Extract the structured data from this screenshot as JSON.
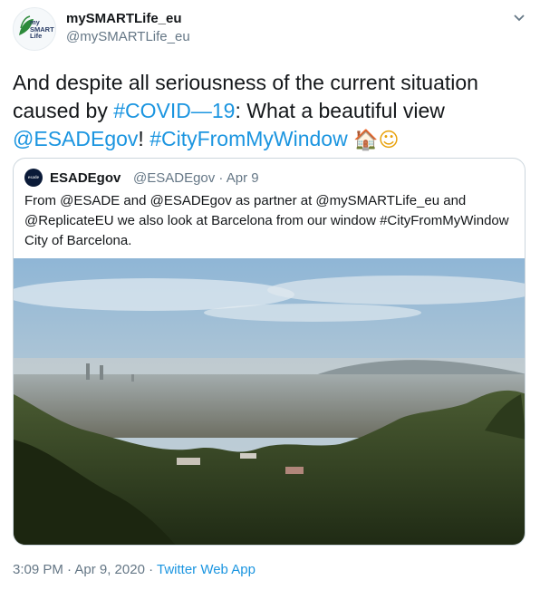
{
  "author": {
    "name": "mySMARTLife_eu",
    "handle": "@mySMARTLife_eu",
    "avatar_text": [
      "my",
      "SMART",
      "Life"
    ]
  },
  "tweet": {
    "text_1": "And despite all seriousness of the current situation caused by ",
    "hashtag_covid": "#COVID—​19",
    "text_2": ": What a beautiful view ",
    "mention": "@ESADEgov",
    "text_3": "! ",
    "hashtag_city": "#CityFromMyWindow",
    "emoji_house": "🏠",
    "emoji_smile": "☺"
  },
  "quoted": {
    "avatar_text": "esade",
    "name": "ESADEgov",
    "meta": "@ESADEgov · Apr 9",
    "text": "From @ESADE and @ESADEgov as partner at @mySMARTLife_eu and @ReplicateEU we also look at Barcelona from our window #CityFromMyWindow City of Barcelona."
  },
  "footer": {
    "time": "3:09 PM · Apr 9, 2020 · ",
    "source": "Twitter Web App"
  },
  "icons": [
    "chevron-down-icon"
  ],
  "colors": {
    "link": "#1b95e0",
    "muted": "#657786",
    "border": "#ccd6dd"
  }
}
